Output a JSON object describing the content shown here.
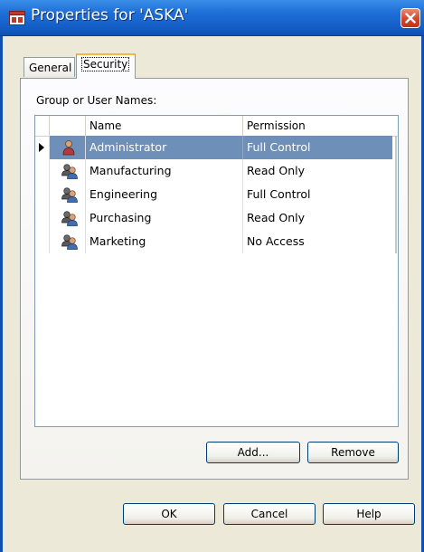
{
  "window": {
    "title": "Properties for 'ASKA'",
    "title_bar_color": "#1f6fd8",
    "close_icon": "close-icon"
  },
  "tabs": [
    {
      "label": "General",
      "active": false
    },
    {
      "label": "Security",
      "active": true
    }
  ],
  "security": {
    "group_label": "Group or User Names:",
    "columns": {
      "name": "Name",
      "permission": "Permission"
    },
    "rows": [
      {
        "name": "Administrator",
        "permission": "Full Control",
        "selected": true,
        "icon": "user-icon"
      },
      {
        "name": "Manufacturing",
        "permission": "Read Only",
        "selected": false,
        "icon": "group-icon"
      },
      {
        "name": "Engineering",
        "permission": "Full Control",
        "selected": false,
        "icon": "group-icon"
      },
      {
        "name": "Purchasing",
        "permission": "Read Only",
        "selected": false,
        "icon": "group-icon"
      },
      {
        "name": "Marketing",
        "permission": "No Access",
        "selected": false,
        "icon": "group-icon"
      }
    ],
    "selection_color": "#6d8fb8",
    "add_label": "Add...",
    "remove_label": "Remove"
  },
  "footer": {
    "ok_label": "OK",
    "cancel_label": "Cancel",
    "help_label": "Help"
  }
}
